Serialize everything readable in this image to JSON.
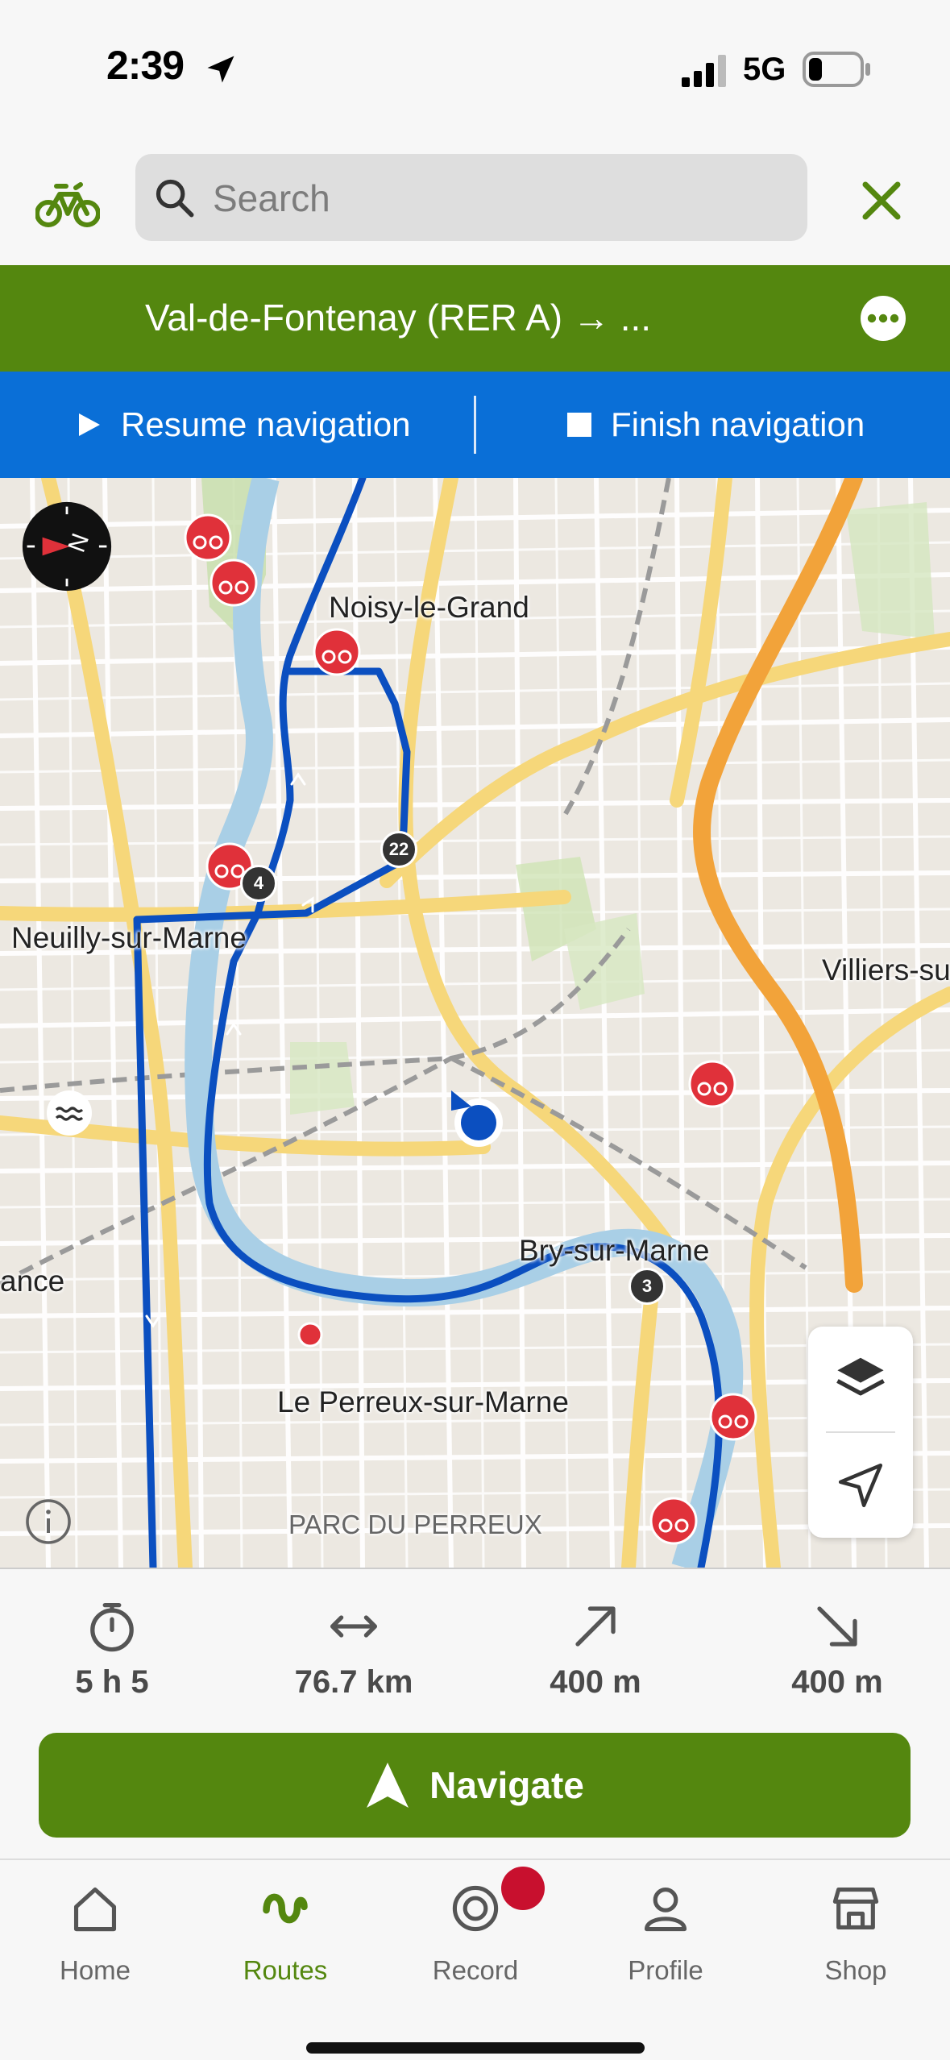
{
  "status_bar": {
    "time": "2:39",
    "network": "5G",
    "battery_level": 0.2
  },
  "search": {
    "placeholder": "Search"
  },
  "route": {
    "title": "Val-de-Fontenay (RER A) → ..."
  },
  "navigation": {
    "resume_label": "Resume navigation",
    "finish_label": "Finish navigation"
  },
  "map": {
    "labels": {
      "noisy": "Noisy-le-Grand",
      "neuilly": "Neuilly-sur-Marne",
      "villiers": "Villiers-su",
      "bry": "Bry-sur-Marne",
      "perreux": "Le Perreux-sur-Marne",
      "parc": "PARC DU PERREUX",
      "ance": "ance"
    },
    "waypoints": [
      "22",
      "4",
      "3"
    ],
    "accent_route": "#0b4fc0",
    "accent_poi": "#e0313a"
  },
  "stats": {
    "duration": "5 h 5",
    "distance": "76.7 km",
    "ascent": "400 m",
    "descent": "400 m"
  },
  "navigate": {
    "label": "Navigate"
  },
  "tabs": [
    {
      "label": "Home",
      "icon": "home-icon"
    },
    {
      "label": "Routes",
      "icon": "routes-icon"
    },
    {
      "label": "Record",
      "icon": "record-icon"
    },
    {
      "label": "Profile",
      "icon": "profile-icon"
    },
    {
      "label": "Shop",
      "icon": "shop-icon"
    }
  ],
  "colors": {
    "brand_green": "#54870f",
    "nav_blue": "#0a6fd7"
  }
}
